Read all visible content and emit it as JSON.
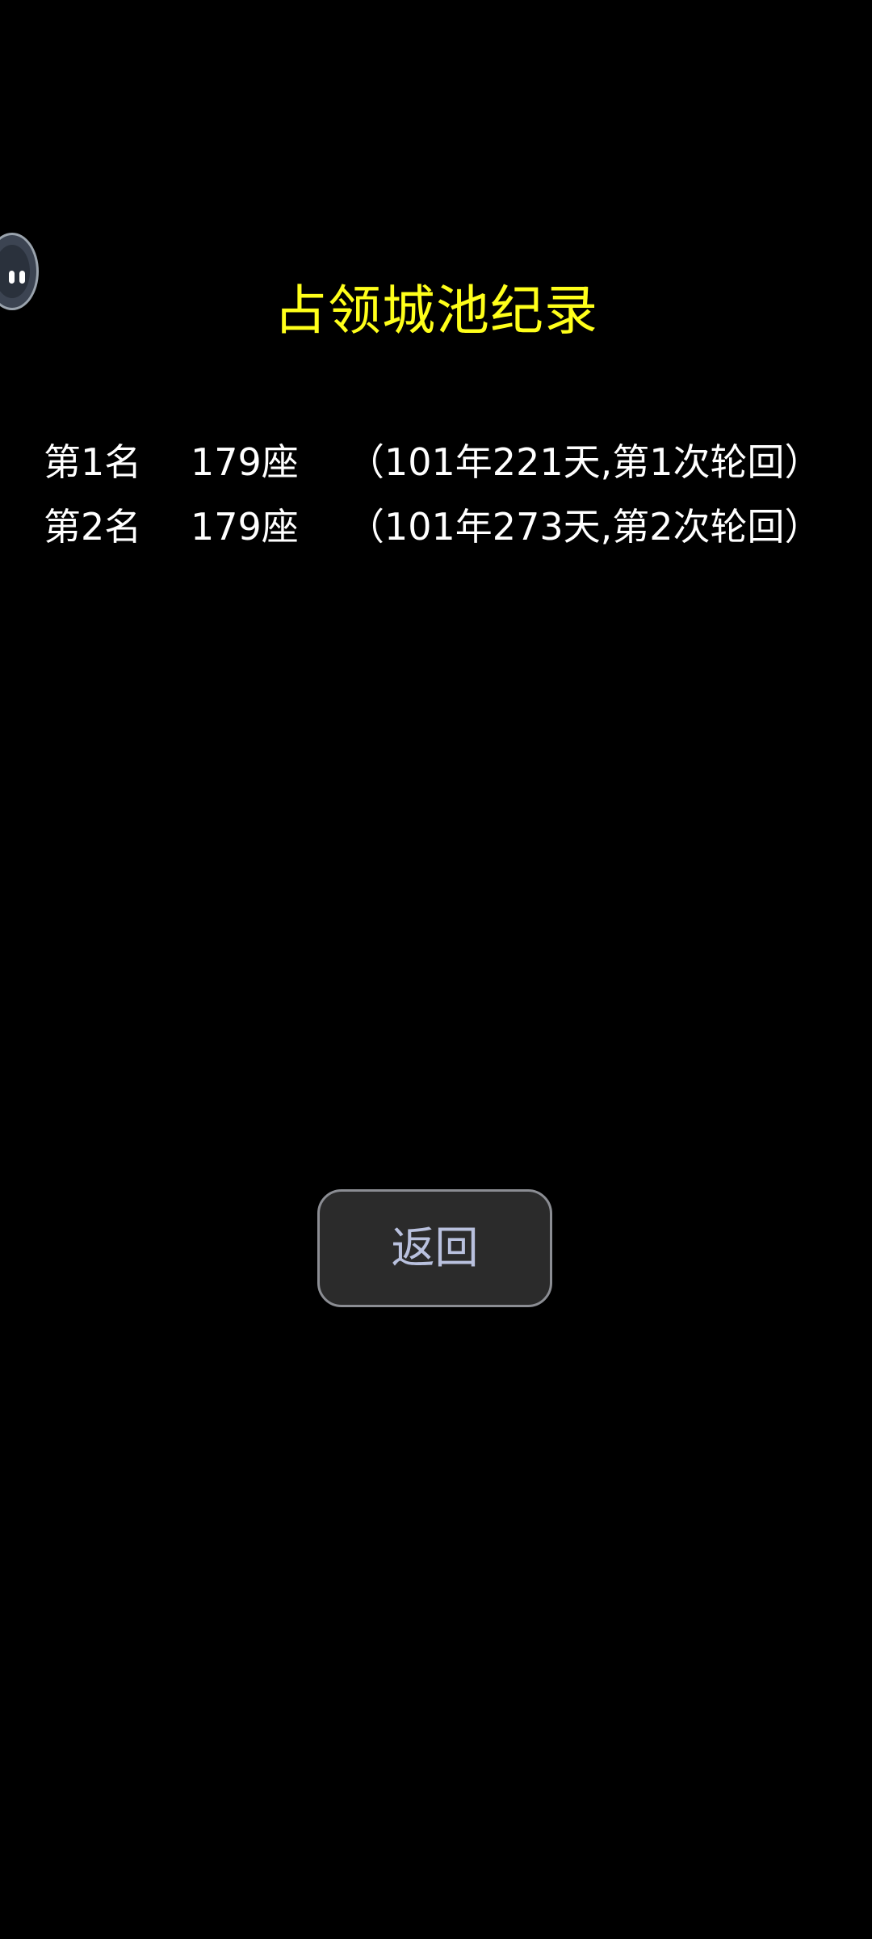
{
  "title": "占领城池纪录",
  "records": [
    {
      "rank": "第1名",
      "count": "179座",
      "detail": "（101年221天,第1次轮回）"
    },
    {
      "rank": "第2名",
      "count": "179座",
      "detail": "（101年273天,第2次轮回）"
    }
  ],
  "back_label": "返回",
  "floating_assistant_icon": "assistant-face-icon",
  "colors": {
    "background": "#000000",
    "title": "#ffff1a",
    "text": "#ffffff",
    "button_bg": "#2b2b2b",
    "button_text": "#b9c1de"
  }
}
